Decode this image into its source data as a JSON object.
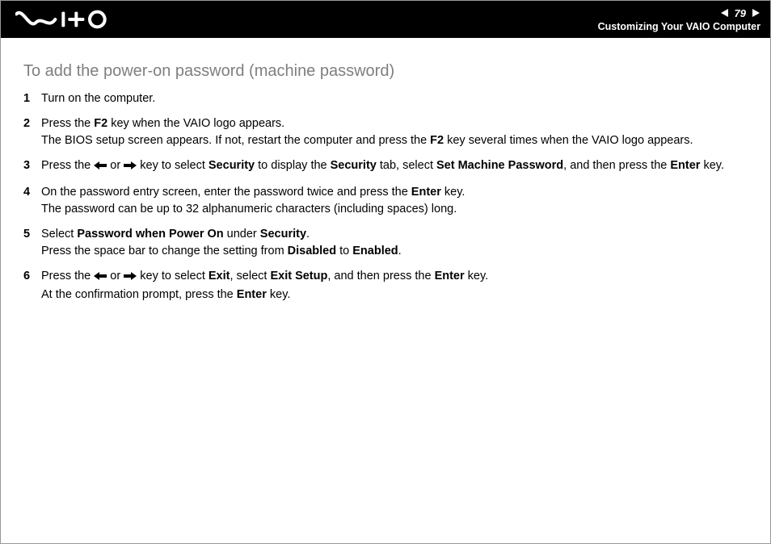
{
  "header": {
    "page_number": "79",
    "section": "Customizing Your VAIO Computer"
  },
  "content": {
    "heading": "To add the power-on password (machine password)",
    "steps": {
      "s1": {
        "num": "1",
        "t1": "Turn on the computer."
      },
      "s2": {
        "num": "2",
        "t1": "Press the ",
        "b1": "F2",
        "t2": " key when the VAIO logo appears.",
        "t3": "The BIOS setup screen appears. If not, restart the computer and press the ",
        "b2": "F2",
        "t4": " key several times when the VAIO logo appears."
      },
      "s3": {
        "num": "3",
        "t1": "Press the ",
        "t2": " or ",
        "t3": " key to select ",
        "b1": "Security",
        "t4": " to display the ",
        "b2": "Security",
        "t5": " tab, select ",
        "b3": "Set Machine Password",
        "t6": ", and then press the ",
        "b4": "Enter",
        "t7": " key."
      },
      "s4": {
        "num": "4",
        "t1": "On the password entry screen, enter the password twice and press the ",
        "b1": "Enter",
        "t2": " key.",
        "t3": "The password can be up to 32 alphanumeric characters (including spaces) long."
      },
      "s5": {
        "num": "5",
        "t1": "Select ",
        "b1": "Password when Power On",
        "t2": " under ",
        "b2": "Security",
        "t3": ".",
        "t4": "Press the space bar to change the setting from ",
        "b3": "Disabled",
        "t5": " to ",
        "b4": "Enabled",
        "t6": "."
      },
      "s6": {
        "num": "6",
        "t1": "Press the ",
        "t2": " or ",
        "t3": " key to select ",
        "b1": "Exit",
        "t4": ", select ",
        "b2": "Exit Setup",
        "t5": ", and then press the ",
        "b3": "Enter",
        "t6": " key.",
        "t7": "At the confirmation prompt, press the ",
        "b4": "Enter",
        "t8": " key."
      }
    }
  }
}
